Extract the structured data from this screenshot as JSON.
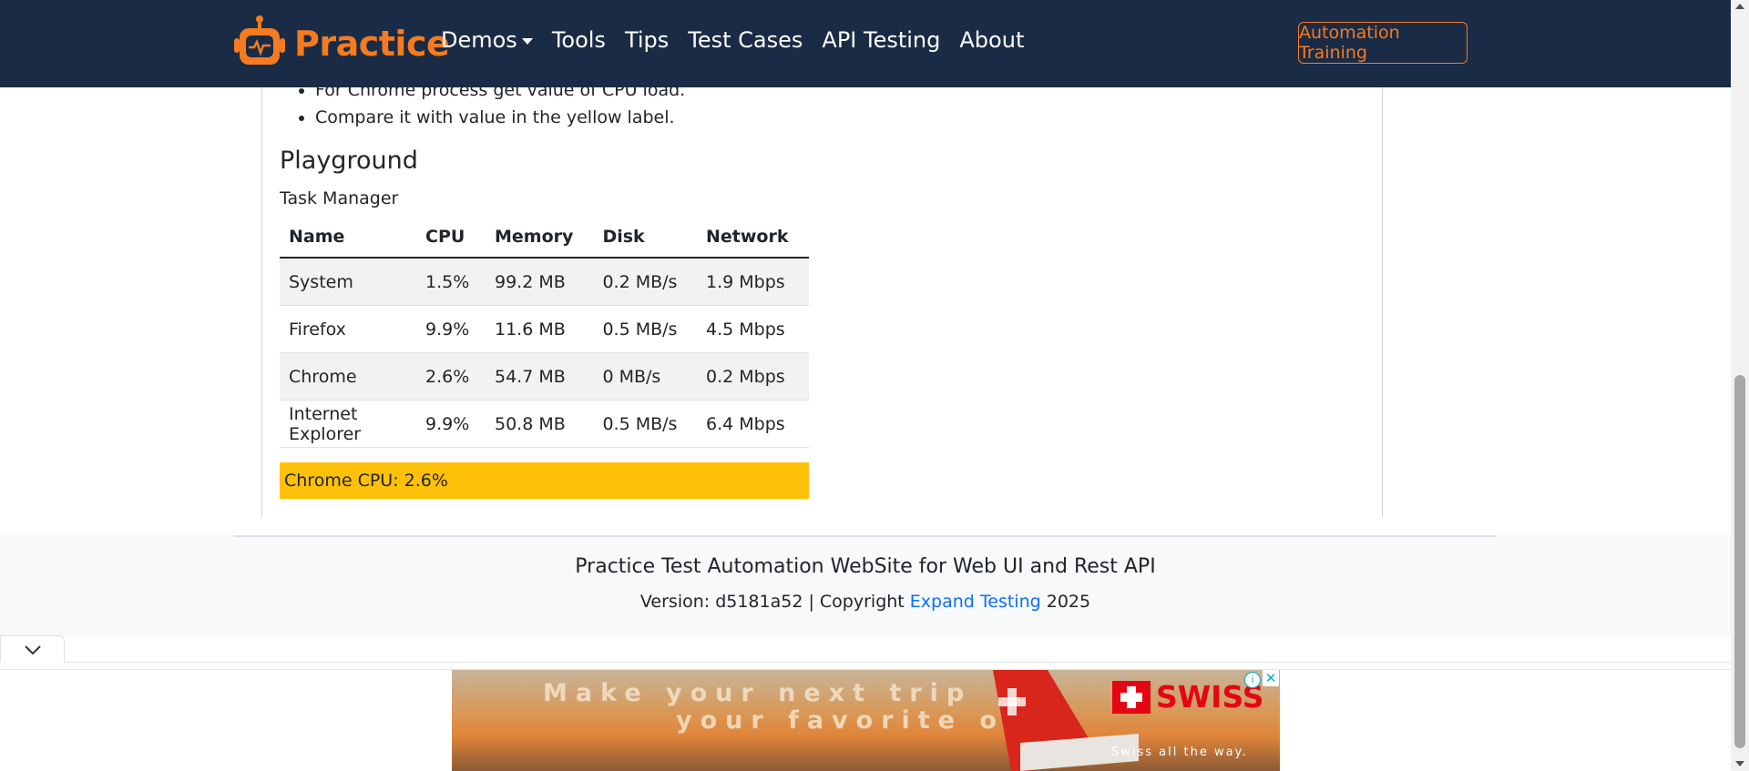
{
  "navbar": {
    "brand": "Practice",
    "links": [
      "Demos",
      "Tools",
      "Tips",
      "Test Cases",
      "API Testing",
      "About"
    ],
    "cta": "Automation Training"
  },
  "instructions": [
    "For Chrome process get value of CPU load.",
    "Compare it with value in the yellow label."
  ],
  "playground": {
    "title": "Playground",
    "caption": "Task Manager",
    "columns": [
      "Name",
      "CPU",
      "Memory",
      "Disk",
      "Network"
    ],
    "rows": [
      [
        "System",
        "1.5%",
        "99.2 MB",
        "0.2 MB/s",
        "1.9 Mbps"
      ],
      [
        "Firefox",
        "9.9%",
        "11.6 MB",
        "0.5 MB/s",
        "4.5 Mbps"
      ],
      [
        "Chrome",
        "2.6%",
        "54.7 MB",
        "0 MB/s",
        "0.2 Mbps"
      ],
      [
        "Internet Explorer",
        "9.9%",
        "50.8 MB",
        "0.5 MB/s",
        "6.4 Mbps"
      ]
    ],
    "label": "Chrome CPU: 2.6%"
  },
  "footer": {
    "title": "Practice Test Automation WebSite for Web UI and Rest API",
    "version_prefix": "Version: d5181a52 | Copyright ",
    "link_text": "Expand Testing",
    "year": " 2025"
  },
  "ad": {
    "line1": "Make your next trip",
    "line2": "your favorite one.",
    "brand": "SWISS",
    "slogan": "Swiss  all  the  way.",
    "info": "i",
    "close": "✕"
  },
  "colors": {
    "navbar_bg": "#1a2b45",
    "brand_accent": "#f57b20",
    "label_bg": "#ffc107",
    "link": "#0d6efd"
  },
  "icons": {
    "brand": "robot-icon",
    "dock_toggle": "chevron-down-icon"
  }
}
